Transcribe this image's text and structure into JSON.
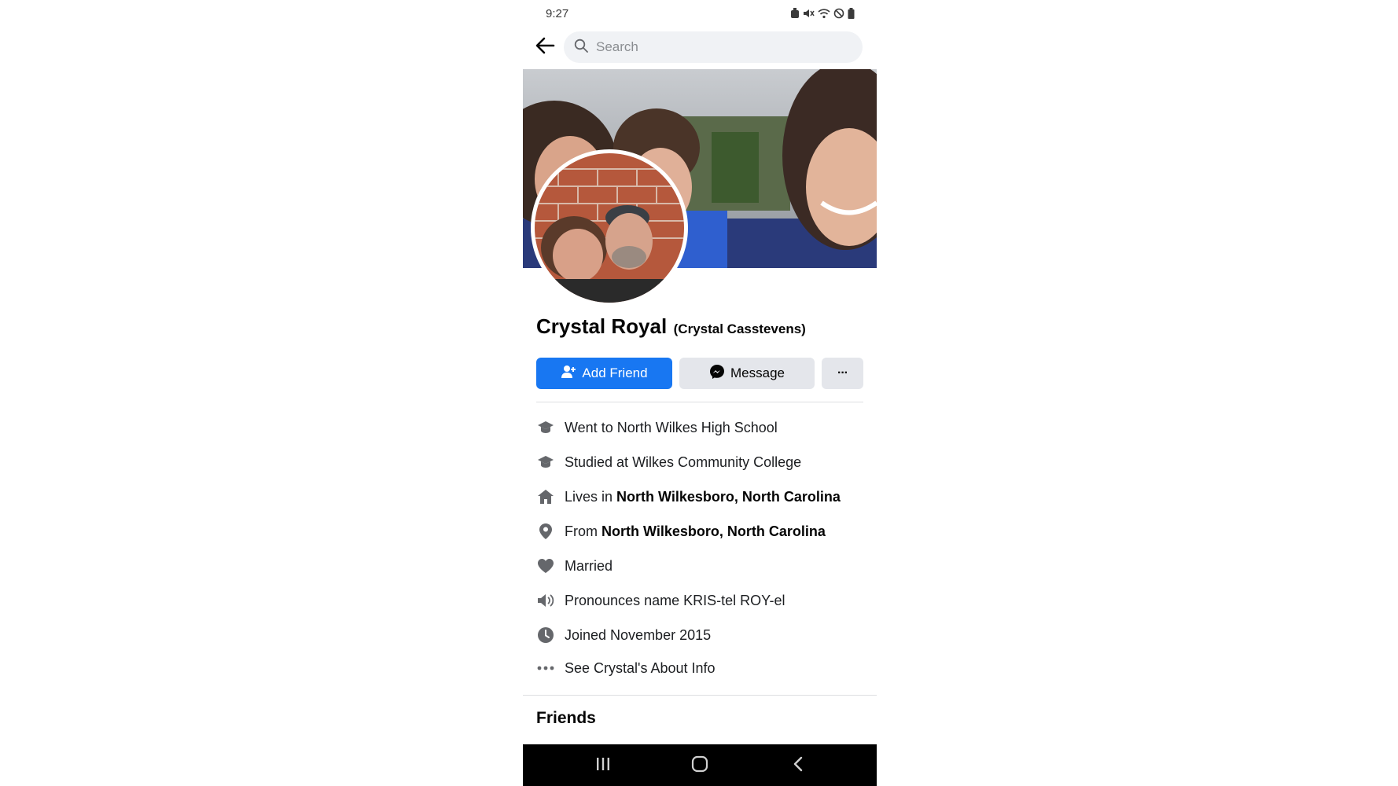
{
  "status_bar": {
    "time": "9:27"
  },
  "search": {
    "placeholder": "Search",
    "value": ""
  },
  "profile": {
    "name": "Crystal Royal",
    "alternate_name": "(Crystal Casstevens)"
  },
  "actions": {
    "add_friend_label": "Add Friend",
    "message_label": "Message",
    "more_label": "···"
  },
  "intro": [
    {
      "icon": "graduation-cap-icon",
      "text": "Went to North Wilkes High School",
      "bold": ""
    },
    {
      "icon": "graduation-cap-icon",
      "text": "Studied at Wilkes Community College",
      "bold": ""
    },
    {
      "icon": "home-icon",
      "text": "Lives in ",
      "bold": "North Wilkesboro, North Carolina"
    },
    {
      "icon": "location-pin-icon",
      "text": "From ",
      "bold": "North Wilkesboro, North Carolina"
    },
    {
      "icon": "heart-icon",
      "text": "Married",
      "bold": ""
    },
    {
      "icon": "speaker-icon",
      "text": "Pronounces name KRIS-tel ROY-el",
      "bold": ""
    },
    {
      "icon": "clock-icon",
      "text": "Joined November 2015",
      "bold": ""
    },
    {
      "icon": "more-dots-icon",
      "text": "See Crystal's About Info",
      "bold": ""
    }
  ],
  "sections": {
    "friends_heading": "Friends"
  },
  "colors": {
    "primary": "#1877f2",
    "secondary_button": "#e4e6eb",
    "icon_gray": "#65676b",
    "nav_bar": "#000000"
  }
}
